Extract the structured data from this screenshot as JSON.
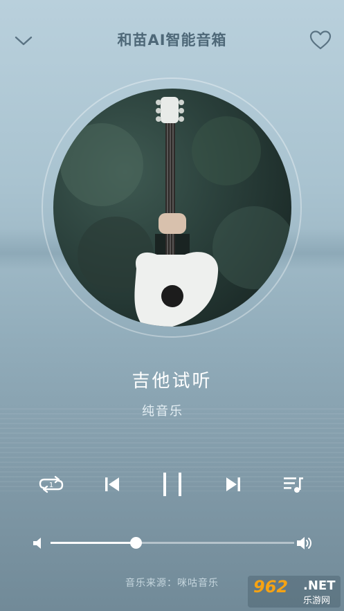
{
  "header": {
    "title": "和苗AI智能音箱",
    "back_icon": "chevron-down-icon",
    "like_icon": "heart-outline-icon"
  },
  "track": {
    "title": "吉他试听",
    "artist": "纯音乐"
  },
  "controls": {
    "repeat_icon": "repeat-one-icon",
    "repeat_badge": "1",
    "prev_icon": "skip-previous-icon",
    "play_state_icon": "pause-icon",
    "next_icon": "skip-next-icon",
    "playlist_icon": "playlist-icon"
  },
  "volume": {
    "level": 0.35,
    "min_icon": "volume-low-icon",
    "max_icon": "volume-high-icon"
  },
  "footer": {
    "source": "音乐来源：咪咕音乐"
  },
  "watermark": {
    "number": "962",
    "suffix": ".NET",
    "site": "乐游网"
  },
  "colors": {
    "accent_white": "#ffffff",
    "title_color": "#4e6878",
    "watermark_orange": "#f6a313"
  }
}
